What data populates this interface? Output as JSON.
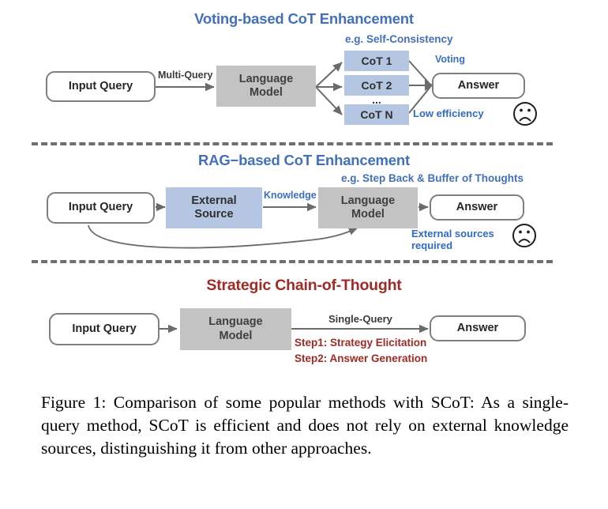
{
  "figure": {
    "panels": [
      {
        "id": "voting",
        "title": "Voting-based CoT Enhancement",
        "subtitle": "e.g. Self-Consistency",
        "title_color": "#4370b8",
        "nodes": {
          "input": "Input Query",
          "model": "Language\nModel",
          "model_line1": "Language",
          "model_line2": "Model",
          "cot1": "CoT 1",
          "cot2": "CoT 2",
          "ellipsis": "...",
          "cotn": "CoT N",
          "answer": "Answer"
        },
        "edges": {
          "multi_query": "Multi-Query",
          "voting": "Voting"
        },
        "note": "Low efficiency",
        "note_icon": "sad-face-icon"
      },
      {
        "id": "rag",
        "title": "RAG−based CoT Enhancement",
        "subtitle": "e.g. Step Back & Buffer of Thoughts",
        "title_color": "#4370b8",
        "nodes": {
          "input": "Input Query",
          "source_line1": "External",
          "source_line2": "Source",
          "model_line1": "Language",
          "model_line2": "Model",
          "answer": "Answer"
        },
        "edges": {
          "knowledge": "Knowledge"
        },
        "note_line1": "External sources",
        "note_line2": "required",
        "note_icon": "sad-face-icon"
      },
      {
        "id": "scot",
        "title": "Strategic Chain-of-Thought",
        "subtitle": "",
        "title_color": "#9e2b25",
        "nodes": {
          "input": "Input Query",
          "model_line1": "Language",
          "model_line2": "Model",
          "answer": "Answer"
        },
        "edges": {
          "single_query": "Single-Query"
        },
        "steps": [
          "Step1: Strategy Elicitation",
          "Step2: Answer Generation"
        ]
      }
    ],
    "caption": "Figure 1: Comparison of some popular methods with SCoT: As a single-query method, SCoT is efficient and does not rely on external knowledge sources, distinguishing it from other approaches.",
    "colors": {
      "blue_title": "#4370b8",
      "red_title": "#9e2b25",
      "blue_box": "#b4c6e2",
      "gray_box": "#c3c3c3",
      "box_border": "#7f7f7f",
      "arrow": "#6b6b6b",
      "separator": "#6f6f6f",
      "note_blue": "#2f6bc0"
    }
  }
}
